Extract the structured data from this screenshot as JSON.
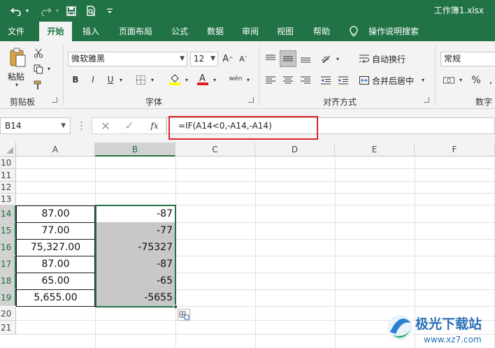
{
  "titlebar": {
    "filename": "工作簿1.xlsx",
    "bg_color": "#217346"
  },
  "tabs": [
    {
      "label": "文件"
    },
    {
      "label": "开始"
    },
    {
      "label": "插入"
    },
    {
      "label": "页面布局"
    },
    {
      "label": "公式"
    },
    {
      "label": "数据"
    },
    {
      "label": "审阅"
    },
    {
      "label": "视图"
    },
    {
      "label": "帮助"
    },
    {
      "label": "操作说明搜索"
    }
  ],
  "ribbon": {
    "paste_label": "粘贴",
    "clipboard_group": "剪贴板",
    "font_name": "微软雅黑",
    "font_size": "12",
    "font_group": "字体",
    "bold": "B",
    "italic": "I",
    "underline": "U",
    "phonetic": "wén",
    "wrap_text": "自动换行",
    "merge_center": "合并后居中",
    "alignment_group": "对齐方式",
    "number_format": "常规",
    "percent": "%",
    "number_group": "数字"
  },
  "formula_bar": {
    "name_box": "B14",
    "formula": "=IF(A14<0,-A14,-A14)"
  },
  "columns": [
    "A",
    "B",
    "C",
    "D",
    "E",
    "F"
  ],
  "rows": [
    "10",
    "11",
    "12",
    "13",
    "14",
    "15",
    "16",
    "17",
    "18",
    "19",
    "20",
    "21"
  ],
  "data": {
    "col_a": [
      "87.00",
      "77.00",
      "75,327.00",
      "87.00",
      "65.00",
      "5,655.00"
    ],
    "col_b": [
      "-87",
      "-77",
      "-75327",
      "-87",
      "-65",
      "-5655"
    ]
  },
  "watermark": {
    "text": "极光下载站",
    "url": "www.xz7.com"
  }
}
